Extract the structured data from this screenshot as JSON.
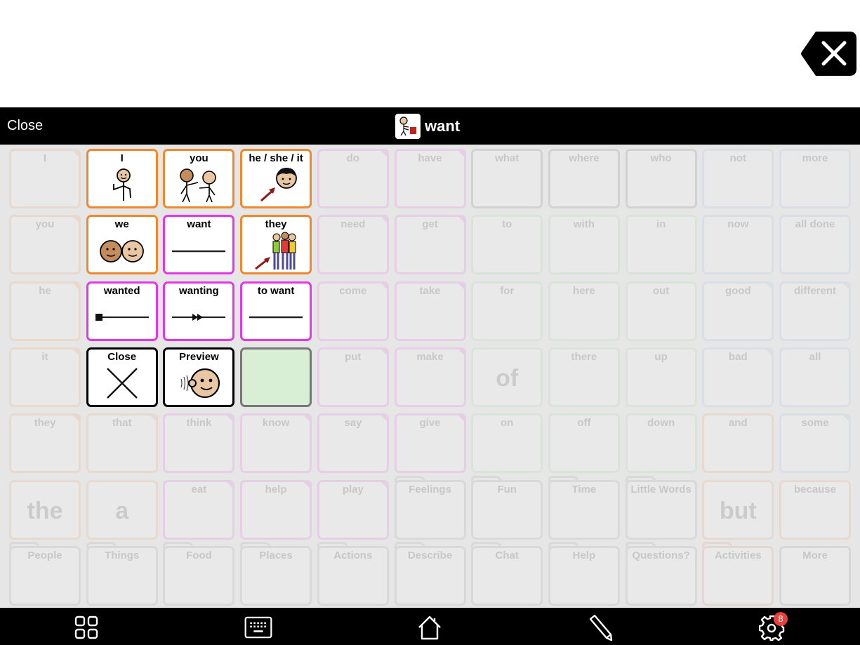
{
  "header": {
    "close_label": "Close",
    "title": "want",
    "backspace_icon": "backspace-x-icon"
  },
  "colors": {
    "pronoun": "#f0882e",
    "verb": "#e536e8",
    "control": "#000000",
    "empty_fill": "#d8efd6",
    "preposition": "#8fd68f",
    "adjective": "#8fb3e6",
    "folder": "#8a8a8a",
    "badge": "#e8413a"
  },
  "popup": {
    "cells": [
      {
        "label": "I",
        "icon": "person-pointing-self-icon",
        "type": "pronoun"
      },
      {
        "label": "you",
        "icon": "two-people-pointing-icon",
        "type": "pronoun"
      },
      {
        "label": "he / she / it",
        "icon": "boy-face-arrow-icon",
        "type": "pronoun"
      },
      {
        "label": "we",
        "icon": "two-faces-icon",
        "type": "pronoun"
      },
      {
        "label": "want",
        "icon": "line-icon",
        "type": "verb"
      },
      {
        "label": "they",
        "icon": "group-people-arrow-icon",
        "type": "pronoun"
      },
      {
        "label": "wanted",
        "icon": "past-tense-line-icon",
        "type": "verb"
      },
      {
        "label": "wanting",
        "icon": "progressive-line-icon",
        "type": "verb"
      },
      {
        "label": "to want",
        "icon": "line-icon",
        "type": "verb"
      },
      {
        "label": "Close",
        "icon": "x-cross-icon",
        "type": "control"
      },
      {
        "label": "Preview",
        "icon": "face-listening-icon",
        "type": "control"
      },
      {
        "label": "",
        "icon": "",
        "type": "empty"
      }
    ]
  },
  "board": {
    "rows": [
      [
        {
          "label": "I",
          "t": "pronoun",
          "fold": true
        },
        {
          "label": "I",
          "t": "pronoun"
        },
        {
          "label": "you",
          "t": "pronoun"
        },
        {
          "label": "he",
          "t": "pronoun"
        },
        {
          "label": "do",
          "t": "verb",
          "fold": true
        },
        {
          "label": "have",
          "t": "verb",
          "fold": true
        },
        {
          "label": "what",
          "t": "question"
        },
        {
          "label": "where",
          "t": "question"
        },
        {
          "label": "who",
          "t": "question"
        },
        {
          "label": "not",
          "t": "adjective"
        },
        {
          "label": "more",
          "t": "adjective"
        }
      ],
      [
        {
          "label": "you",
          "t": "pronoun",
          "fold": true
        },
        {
          "label": "we",
          "t": "pronoun"
        },
        {
          "label": "want",
          "t": "verb"
        },
        {
          "label": "they",
          "t": "pronoun"
        },
        {
          "label": "need",
          "t": "verb",
          "fold": true
        },
        {
          "label": "get",
          "t": "verb",
          "fold": true
        },
        {
          "label": "to",
          "t": "preposition"
        },
        {
          "label": "with",
          "t": "preposition"
        },
        {
          "label": "in",
          "t": "preposition"
        },
        {
          "label": "now",
          "t": "adjective"
        },
        {
          "label": "all done",
          "t": "adjective"
        }
      ],
      [
        {
          "label": "he",
          "t": "pronoun",
          "fold": true
        },
        {
          "label": "",
          "t": "verb"
        },
        {
          "label": "",
          "t": "verb"
        },
        {
          "label": "",
          "t": "verb"
        },
        {
          "label": "come",
          "t": "verb",
          "fold": true
        },
        {
          "label": "take",
          "t": "verb",
          "fold": true
        },
        {
          "label": "for",
          "t": "preposition"
        },
        {
          "label": "here",
          "t": "preposition"
        },
        {
          "label": "out",
          "t": "preposition"
        },
        {
          "label": "good",
          "t": "adjective",
          "fold": true
        },
        {
          "label": "different",
          "t": "adjective",
          "fold": true
        }
      ],
      [
        {
          "label": "it",
          "t": "pronoun",
          "fold": true
        },
        {
          "label": "",
          "t": "control"
        },
        {
          "label": "",
          "t": "control"
        },
        {
          "label": "",
          "t": "control"
        },
        {
          "label": "put",
          "t": "verb",
          "fold": true
        },
        {
          "label": "make",
          "t": "verb",
          "fold": true
        },
        {
          "label": "",
          "big": "of",
          "t": "preposition"
        },
        {
          "label": "there",
          "t": "preposition"
        },
        {
          "label": "up",
          "t": "preposition"
        },
        {
          "label": "bad",
          "t": "adjective",
          "fold": true
        },
        {
          "label": "all",
          "t": "adjective"
        }
      ],
      [
        {
          "label": "they",
          "t": "pronoun",
          "fold": true
        },
        {
          "label": "that",
          "t": "pronoun",
          "fold": true
        },
        {
          "label": "think",
          "t": "verb",
          "fold": true
        },
        {
          "label": "know",
          "t": "verb",
          "fold": true
        },
        {
          "label": "say",
          "t": "verb",
          "fold": true
        },
        {
          "label": "give",
          "t": "verb",
          "fold": true
        },
        {
          "label": "on",
          "t": "preposition"
        },
        {
          "label": "off",
          "t": "preposition"
        },
        {
          "label": "down",
          "t": "preposition"
        },
        {
          "label": "and",
          "t": "pronoun"
        },
        {
          "label": "some",
          "t": "adjective",
          "fold": true
        }
      ],
      [
        {
          "label": "",
          "big": "the",
          "t": "pronoun"
        },
        {
          "label": "",
          "big": "a",
          "t": "pronoun"
        },
        {
          "label": "eat",
          "t": "verb",
          "fold": true
        },
        {
          "label": "help",
          "t": "verb",
          "fold": true
        },
        {
          "label": "play",
          "t": "verb",
          "fold": true
        },
        {
          "label": "Feelings",
          "t": "folder"
        },
        {
          "label": "Fun",
          "t": "folder"
        },
        {
          "label": "Time",
          "t": "folder"
        },
        {
          "label": "Little Words",
          "t": "folder"
        },
        {
          "label": "",
          "big": "but",
          "t": "pronoun"
        },
        {
          "label": "because",
          "t": "pronoun"
        }
      ],
      [
        {
          "label": "People",
          "t": "folder"
        },
        {
          "label": "Things",
          "t": "folder"
        },
        {
          "label": "Food",
          "t": "folder"
        },
        {
          "label": "Places",
          "t": "folder"
        },
        {
          "label": "Actions",
          "t": "folder"
        },
        {
          "label": "Describe",
          "t": "folder"
        },
        {
          "label": "Chat",
          "t": "folder"
        },
        {
          "label": "Help",
          "t": "folder"
        },
        {
          "label": "Questions?",
          "t": "folder"
        },
        {
          "label": "Activities",
          "t": "folder-red"
        },
        {
          "label": "More",
          "t": "control-gray"
        }
      ]
    ]
  },
  "bottom_bar": {
    "items": [
      {
        "name": "grid-view-icon"
      },
      {
        "name": "keyboard-icon"
      },
      {
        "name": "home-icon"
      },
      {
        "name": "pencil-edit-icon"
      },
      {
        "name": "settings-gear-icon",
        "badge": "8"
      }
    ]
  }
}
